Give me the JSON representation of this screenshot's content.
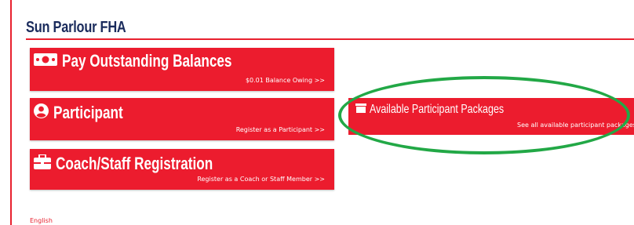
{
  "header": {
    "title": "Sun Parlour FHA"
  },
  "cards": {
    "balances": {
      "title": "Pay Outstanding Balances",
      "link": "$0.01 Balance Owing >>",
      "icon": "money-bill-icon"
    },
    "participant": {
      "title": "Participant",
      "link": "Register as a Participant >>",
      "icon": "user-circle-icon"
    },
    "coach": {
      "title": "Coach/Staff Registration",
      "link": "Register as a Coach or Staff Member >>",
      "icon": "briefcase-icon"
    },
    "packages": {
      "title": "Available Participant Packages",
      "link": "See all available participant packages >>",
      "icon": "package-icon"
    }
  },
  "footer": {
    "language": "English"
  },
  "colors": {
    "card_red": "#ec1c2e",
    "title_navy": "#1a2b5c",
    "highlight_green": "#22a846"
  }
}
